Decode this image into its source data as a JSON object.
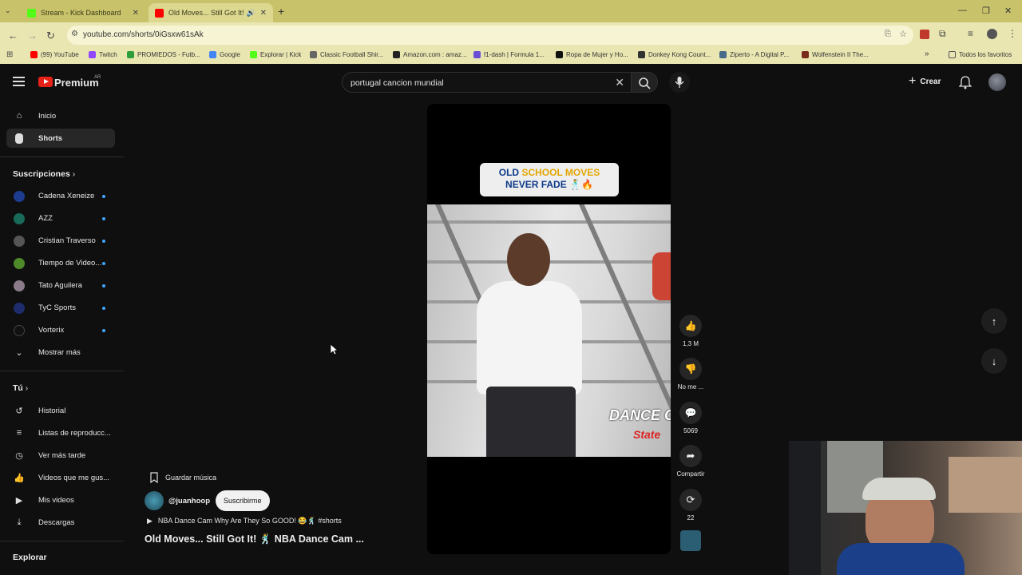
{
  "browser": {
    "tabs": [
      {
        "title": "Stream - Kick Dashboard",
        "fav_color": "#53fc18"
      },
      {
        "title": "Old Moves... Still Got It! 🕺",
        "fav_color": "#ff0000"
      }
    ],
    "url": "youtube.com/shorts/0iGsxw61sAk",
    "bookmarks": [
      {
        "label": "(99) YouTube",
        "color": "#ff0000"
      },
      {
        "label": "Twitch",
        "color": "#9146ff"
      },
      {
        "label": "PROMIEDOS - Futb...",
        "color": "#2e9e3a"
      },
      {
        "label": "Google",
        "color": "#4285f4"
      },
      {
        "label": "Explorar | Kick",
        "color": "#53fc18"
      },
      {
        "label": "Classic Football Shir...",
        "color": "#666666"
      },
      {
        "label": "Amazon.com : amaz...",
        "color": "#222222"
      },
      {
        "label": "f1-dash | Formula 1...",
        "color": "#6a4fd6"
      },
      {
        "label": "Ropa de Mujer y Ho...",
        "color": "#111111"
      },
      {
        "label": "Donkey Kong Count...",
        "color": "#333333"
      },
      {
        "label": "Ziperto - A Digital P...",
        "color": "#4a6b8a"
      },
      {
        "label": "Wolfenstein II The...",
        "color": "#7a2b1c"
      }
    ],
    "all_bookmarks": "Todos los favoritos"
  },
  "masthead": {
    "brand": "Premium",
    "country": "AR",
    "search_value": "portugal cancion mundial",
    "create_label": "Crear"
  },
  "sidebar": {
    "main": [
      {
        "label": "Inicio",
        "icon": "home-icon"
      },
      {
        "label": "Shorts",
        "icon": "shorts-icon"
      }
    ],
    "subs_heading": "Suscripciones",
    "subscriptions": [
      {
        "label": "Cadena Xeneize",
        "color": "#1d3c8f"
      },
      {
        "label": "AZZ",
        "color": "#1a6a5a"
      },
      {
        "label": "Cristian Traverso",
        "color": "#555555"
      },
      {
        "label": "Tiempo de Video...",
        "color": "#4f8a2a"
      },
      {
        "label": "Tato Aguilera",
        "color": "#8a7a8a"
      },
      {
        "label": "TyC Sports",
        "color": "#1e2c6e"
      },
      {
        "label": "Vorterix",
        "color": "#111111"
      }
    ],
    "show_more": "Mostrar más",
    "you_heading": "Tú",
    "you_items": [
      {
        "label": "Historial",
        "icon": "history-icon"
      },
      {
        "label": "Listas de reproducc...",
        "icon": "playlists-icon"
      },
      {
        "label": "Ver más tarde",
        "icon": "watch-later-icon"
      },
      {
        "label": "Videos que me gus...",
        "icon": "like-icon"
      },
      {
        "label": "Mis videos",
        "icon": "my-videos-icon"
      },
      {
        "label": "Descargas",
        "icon": "download-icon"
      }
    ],
    "explore_heading": "Explorar"
  },
  "short": {
    "caption_line1_a": "OLD ",
    "caption_line1_b": "SCHOOL MOVES",
    "caption_line2": "NEVER FADE 🕺🔥",
    "overlay_text": "DANCE C",
    "overlay_sub": "State",
    "progress": 0.3,
    "save_music": "Guardar música",
    "channel": "@juanhoop",
    "subscribe": "Suscribirme",
    "description": "NBA Dance Cam Why Are They So GOOD! 😂🕺 #shorts",
    "title": "Old Moves... Still Got It! 🕺 NBA Dance Cam ..."
  },
  "actions": {
    "likes": "1,3 M",
    "dislike": "No me ...",
    "comments": "5069",
    "share": "Compartir",
    "remix": "22"
  }
}
